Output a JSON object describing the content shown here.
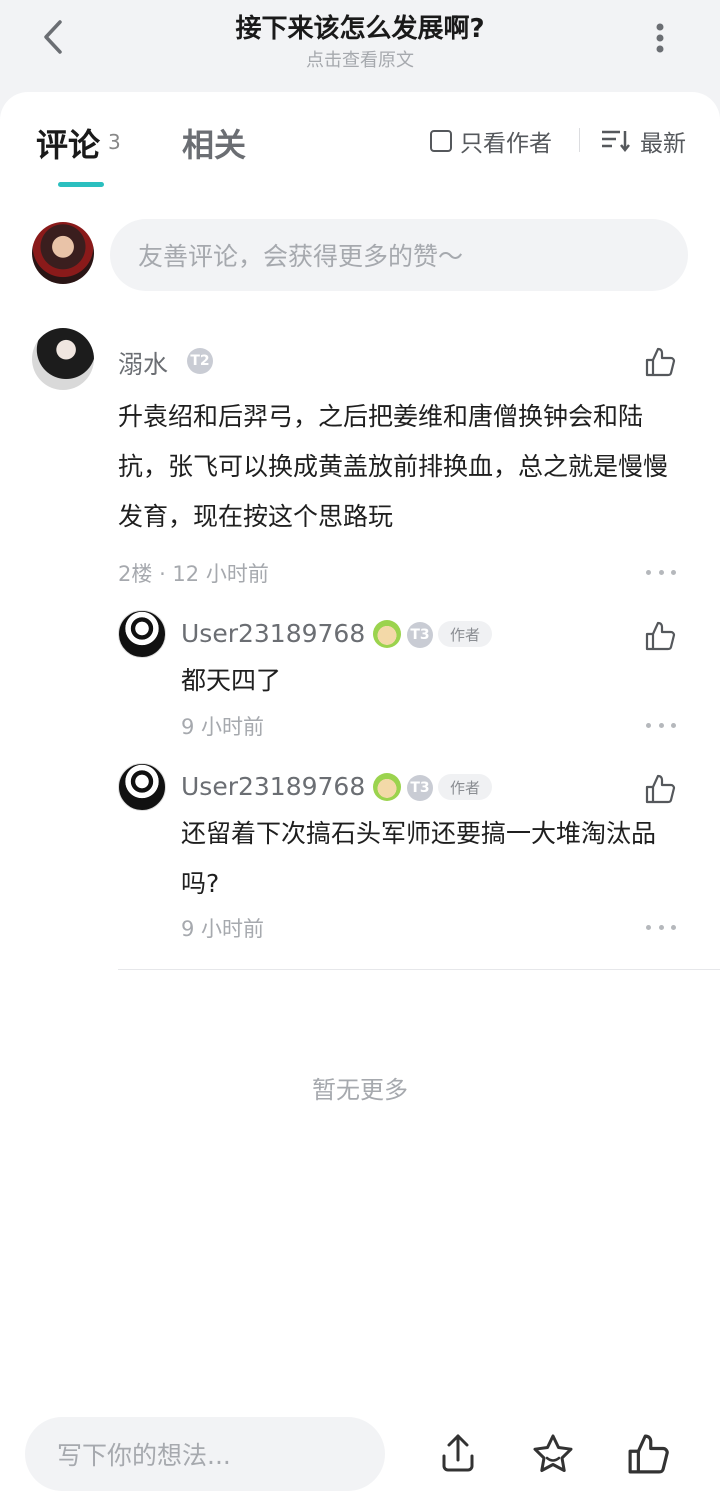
{
  "header": {
    "title": "接下来该怎么发展啊?",
    "subtitle": "点击查看原文"
  },
  "tabs": {
    "comments_label": "评论",
    "comments_count": "3",
    "related_label": "相关"
  },
  "filters": {
    "only_author": "只看作者",
    "sort": "最新"
  },
  "composer": {
    "placeholder": "友善评论，会获得更多的赞～"
  },
  "comments": [
    {
      "user": "溺水",
      "level_badge": "T2",
      "text": "升袁绍和后羿弓，之后把姜维和唐僧换钟会和陆抗，张飞可以换成黄盖放前排换血，总之就是慢慢发育，现在按这个思路玩",
      "floor": "2楼",
      "time": "12 小时前",
      "replies": [
        {
          "user": "User23189768",
          "level_badge": "T3",
          "author_tag": "作者",
          "text": "都天四了",
          "time": "9 小时前"
        },
        {
          "user": "User23189768",
          "level_badge": "T3",
          "author_tag": "作者",
          "text": "还留着下次搞石头军师还要搞一大堆淘汰品吗?",
          "time": "9 小时前"
        }
      ]
    }
  ],
  "footer": {
    "no_more": "暂无更多"
  },
  "bottom_bar": {
    "placeholder": "写下你的想法..."
  },
  "icons": {
    "back": "chevron-left-icon",
    "more": "more-vertical-icon",
    "sort": "sort-lines-icon",
    "like": "thumbs-up-icon",
    "reply_more": "more-horizontal-icon",
    "share": "share-upload-icon",
    "favorite": "star-icon"
  },
  "colors": {
    "accent": "#2bbfbf",
    "muted": "#a6a9ae",
    "bg": "#f2f3f5"
  }
}
